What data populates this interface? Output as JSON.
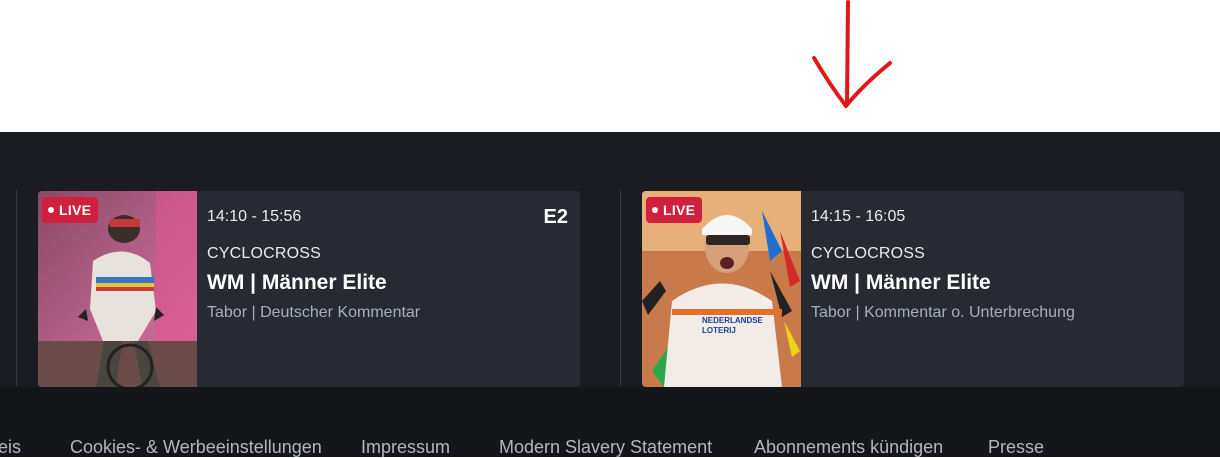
{
  "annotation": {
    "color": "#e0181b"
  },
  "cards": [
    {
      "live_label": "LIVE",
      "time": "14:10 - 15:56",
      "sport": "CYCLOCROSS",
      "title": "WM | Männer Elite",
      "subtitle": "Tabor | Deutscher Kommentar",
      "channel": "E2",
      "thumbnail_icon": "cyclist-rainbow-jersey-photo"
    },
    {
      "live_label": "LIVE",
      "time": "14:15 - 16:05",
      "sport": "CYCLOCROSS",
      "title": "WM | Männer Elite",
      "subtitle": "Tabor | Kommentar o. Unterbrechung",
      "thumbnail_icon": "cyclist-celebrating-photo"
    }
  ],
  "footer": {
    "links": [
      "eis",
      "Cookies- & Werbeeinstellungen",
      "Impressum",
      "Modern Slavery Statement",
      "Abonnements kündigen",
      "Presse"
    ]
  },
  "colors": {
    "live_badge": "#d11f3e",
    "card_bg": "#272a32",
    "page_bg": "#1b1c21",
    "footer_bg": "#15161a"
  }
}
